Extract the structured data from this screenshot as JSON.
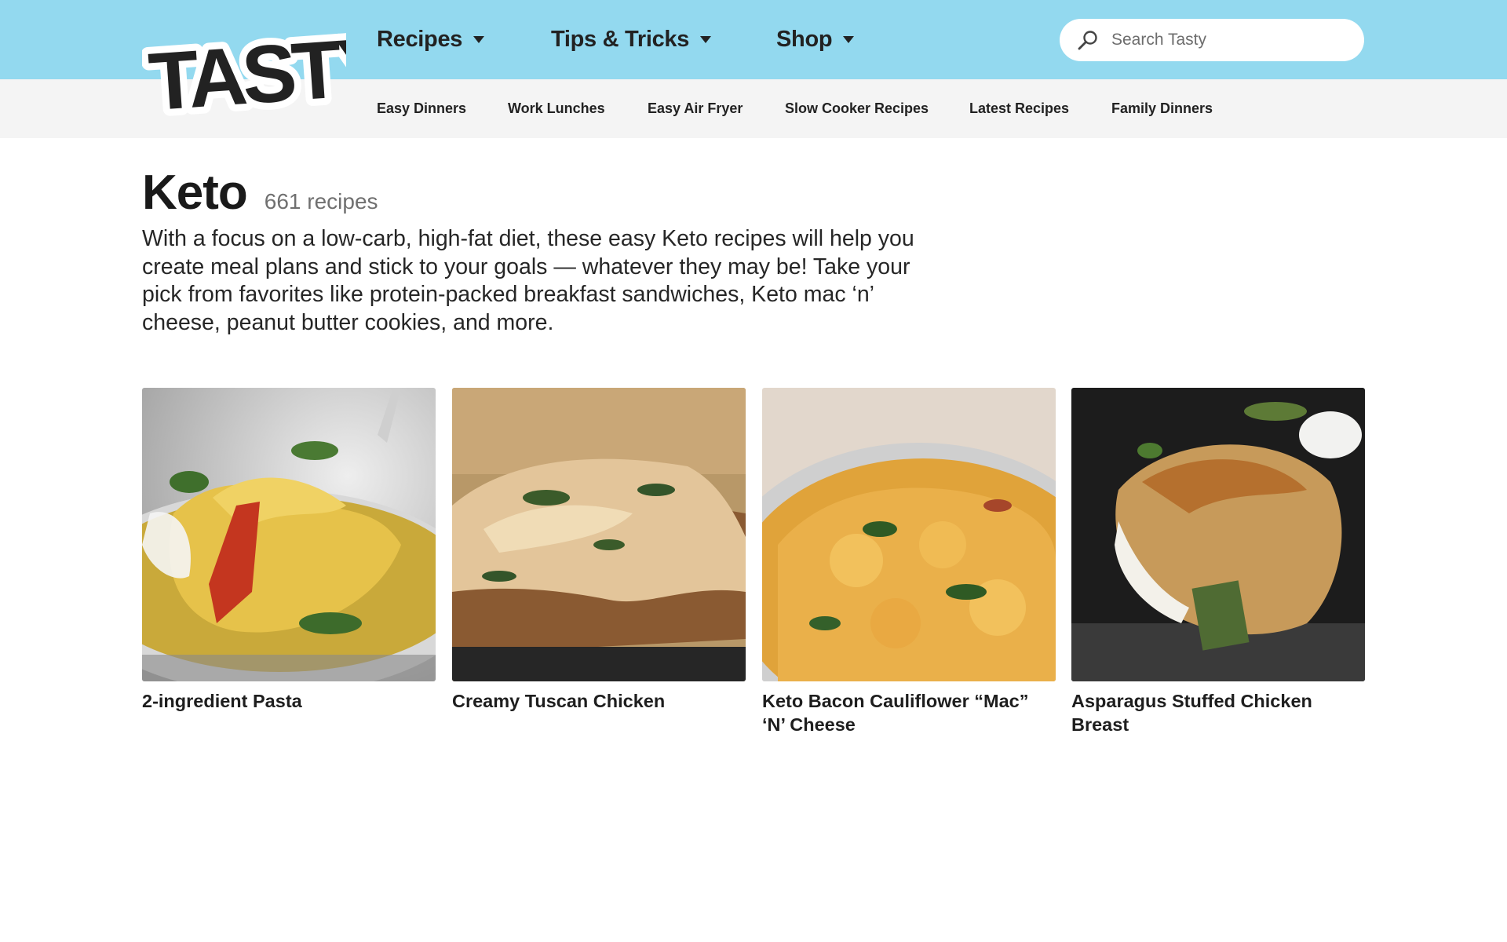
{
  "header": {
    "logo_text": "TASTY",
    "nav": [
      {
        "label": "Recipes"
      },
      {
        "label": "Tips & Tricks"
      },
      {
        "label": "Shop"
      }
    ],
    "search": {
      "placeholder": "Search Tasty",
      "value": ""
    },
    "colors": {
      "topbar": "#93d9ef",
      "subbar": "#f4f4f4"
    }
  },
  "subnav": [
    {
      "label": "Easy Dinners"
    },
    {
      "label": "Work Lunches"
    },
    {
      "label": "Easy Air Fryer"
    },
    {
      "label": "Slow Cooker Recipes"
    },
    {
      "label": "Latest Recipes"
    },
    {
      "label": "Family Dinners"
    }
  ],
  "main": {
    "title": "Keto",
    "count": "661 recipes",
    "description": "With a focus on a low-carb, high-fat diet, these easy Keto recipes will help you create meal plans and stick to your goals — whatever they may be! Take your pick from favorites like protein-packed breakfast sandwiches, Keto mac ‘n’ cheese, peanut butter cookies, and more."
  },
  "cards": [
    {
      "title": "2-ingredient Pasta",
      "image": "pasta-photo"
    },
    {
      "title": "Creamy Tuscan Chicken",
      "image": "tuscan-chicken-photo"
    },
    {
      "title": "Keto Bacon Cauliflower “Mac” ‘N’ Cheese",
      "image": "cauliflower-mac-photo"
    },
    {
      "title": "Asparagus Stuffed Chicken Breast",
      "image": "stuffed-chicken-photo"
    }
  ]
}
